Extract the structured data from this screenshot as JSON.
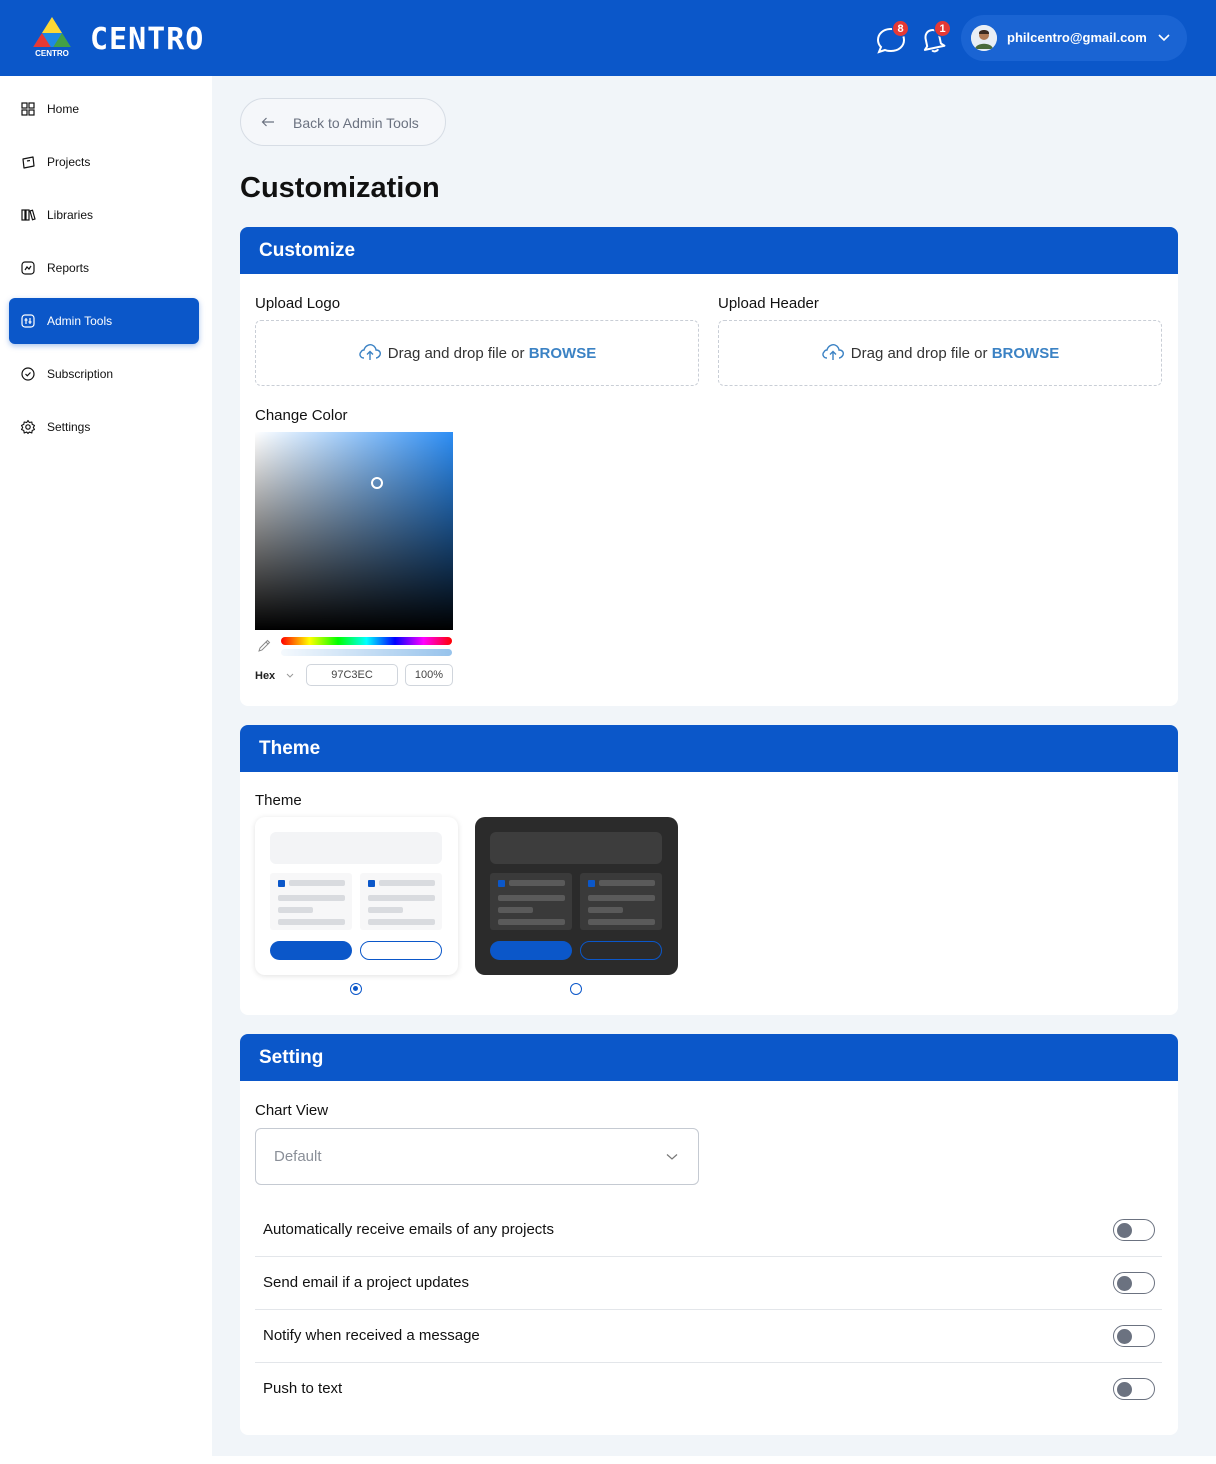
{
  "header": {
    "brand": "CENTRO",
    "logo_text": "CENTRO",
    "messages_count": "8",
    "notifications_count": "1",
    "user_email": "philcentro@gmail.com"
  },
  "sidebar": {
    "items": [
      {
        "label": "Home",
        "icon": "grid-icon",
        "active": false
      },
      {
        "label": "Projects",
        "icon": "projects-icon",
        "active": false
      },
      {
        "label": "Libraries",
        "icon": "books-icon",
        "active": false
      },
      {
        "label": "Reports",
        "icon": "report-icon",
        "active": false
      },
      {
        "label": "Admin Tools",
        "icon": "admin-icon",
        "active": true
      },
      {
        "label": "Subscription",
        "icon": "check-circle-icon",
        "active": false
      },
      {
        "label": "Settings",
        "icon": "gear-icon",
        "active": false
      }
    ]
  },
  "main": {
    "back_label": "Back to Admin Tools",
    "page_title": "Customization",
    "customize": {
      "title": "Customize",
      "upload_logo_label": "Upload Logo",
      "upload_header_label": "Upload Header",
      "dropzone_text": "Drag and drop file or ",
      "dropzone_browse": "BROWSE",
      "change_color_label": "Change Color",
      "color_format": "Hex",
      "hex_value": "97C3EC",
      "alpha_value": "100%"
    },
    "theme": {
      "title": "Theme",
      "label": "Theme",
      "options": [
        {
          "name": "light",
          "selected": true
        },
        {
          "name": "dark",
          "selected": false
        }
      ]
    },
    "setting": {
      "title": "Setting",
      "chart_view_label": "Chart View",
      "chart_view_value": "Default",
      "toggles": [
        {
          "label": "Automatically receive emails of any projects",
          "on": false
        },
        {
          "label": "Send email if a project updates",
          "on": false
        },
        {
          "label": "Notify when received a message",
          "on": false
        },
        {
          "label": "Push to text",
          "on": false
        }
      ]
    }
  },
  "colors": {
    "primary": "#0b57c9",
    "badge": "#e53935",
    "browse": "#3b82c4",
    "background": "#f1f5f9"
  }
}
